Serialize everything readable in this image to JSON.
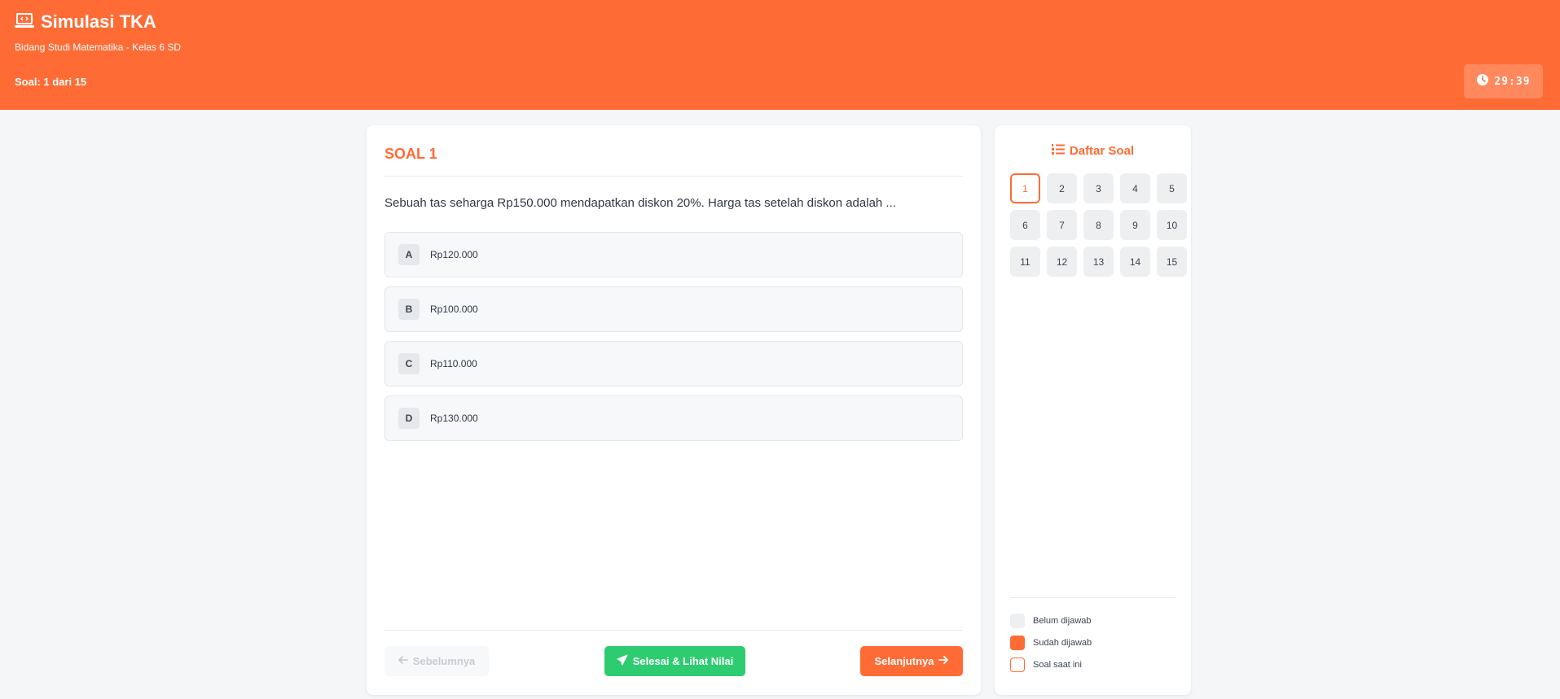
{
  "header": {
    "title": "Simulasi TKA",
    "subtitle": "Bidang Studi Matematika - Kelas 6 SD",
    "counter": "Soal: 1 dari 15",
    "timer": "29:39"
  },
  "question": {
    "label": "SOAL 1",
    "text": "Sebuah tas seharga Rp150.000 mendapatkan diskon 20%. Harga tas setelah diskon adalah ...",
    "options": [
      {
        "letter": "A",
        "text": "Rp120.000"
      },
      {
        "letter": "B",
        "text": "Rp100.000"
      },
      {
        "letter": "C",
        "text": "Rp110.000"
      },
      {
        "letter": "D",
        "text": "Rp130.000"
      }
    ]
  },
  "nav": {
    "prev_label": "Sebelumnya",
    "finish_label": "Selesai & Lihat Nilai",
    "next_label": "Selanjutnya"
  },
  "sidebar": {
    "title": "Daftar Soal",
    "numbers": [
      "1",
      "2",
      "3",
      "4",
      "5",
      "6",
      "7",
      "8",
      "9",
      "10",
      "11",
      "12",
      "13",
      "14",
      "15"
    ],
    "current": "1",
    "legend": [
      {
        "label": "Belum dijawab"
      },
      {
        "label": "Sudah dijawab"
      },
      {
        "label": "Soal saat ini"
      }
    ]
  },
  "colors": {
    "accent": "#ff6b35",
    "success": "#2ecc71",
    "background": "#f5f6f8"
  },
  "icons": {
    "brand": "laptop-code-icon",
    "timer": "clock-icon",
    "list": "list-ol-icon",
    "prev": "arrow-left-icon",
    "finish": "paper-plane-icon",
    "next": "arrow-right-icon"
  }
}
